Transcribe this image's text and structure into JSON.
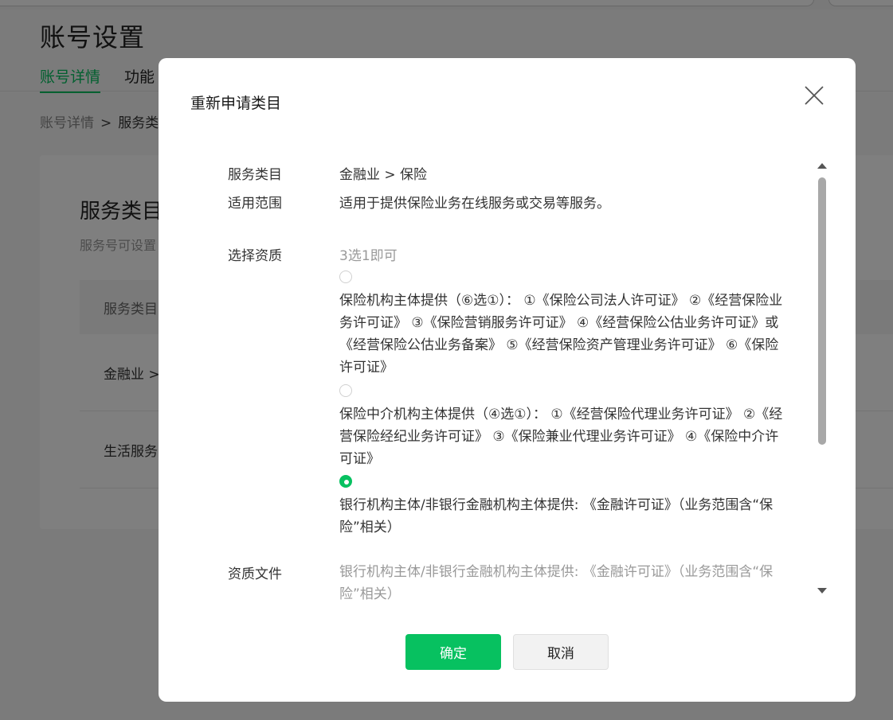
{
  "colors": {
    "accent": "#07c160",
    "overlay": "rgba(0,0,0,0.5)"
  },
  "background": {
    "page_title": "账号设置",
    "tabs": [
      {
        "label": "账号详情",
        "active": true
      },
      {
        "label": "功能"
      }
    ],
    "breadcrumb": {
      "root": "账号详情",
      "separator": ">",
      "current": "服务类"
    },
    "card": {
      "title": "服务类目",
      "description": "服务号可设置",
      "table_header": "服务类目",
      "rows": [
        "金融业 >",
        "生活服务"
      ]
    }
  },
  "modal": {
    "title": "重新申请类目",
    "close_icon": "close-icon",
    "fields": {
      "service_category": {
        "label": "服务类目",
        "value": "金融业 > 保险"
      },
      "scope": {
        "label": "适用范围",
        "value": "适用于提供保险业务在线服务或交易等服务。"
      },
      "qualification_select": {
        "label": "选择资质",
        "hint": "3选1即可",
        "options": [
          {
            "text": "保险机构主体提供（⑥选①）： ①《保险公司法人许可证》 ②《经营保险业务许可证》 ③《保险营销服务许可证》 ④《经营保险公估业务许可证》或《经营保险公估业务备案》 ⑤《经营保险资产管理业务许可证》 ⑥《保险许可证》",
            "selected": false
          },
          {
            "text": "保险中介机构主体提供（④选①）： ①《经营保险代理业务许可证》 ②《经营保险经纪业务许可证》 ③《保险兼业代理业务许可证》 ④《保险中介许可证》",
            "selected": false
          },
          {
            "text": "银行机构主体/非银行金融机构主体提供: 《金融许可证》（业务范围含“保险”相关）",
            "selected": true
          }
        ]
      },
      "qualification_file": {
        "label": "资质文件",
        "value": "银行机构主体/非银行金融机构主体提供: 《金融许可证》（业务范围含“保险”相关）"
      }
    },
    "buttons": {
      "confirm": "确定",
      "cancel": "取消"
    }
  }
}
